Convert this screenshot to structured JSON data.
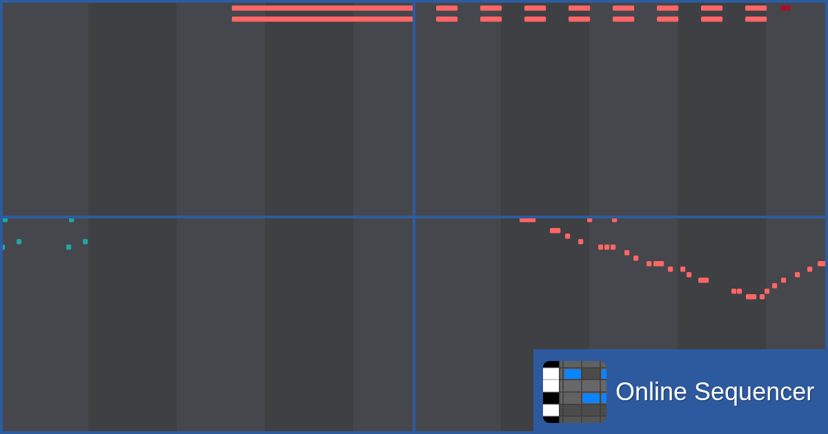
{
  "brand": {
    "name": "Online Sequencer"
  }
}
